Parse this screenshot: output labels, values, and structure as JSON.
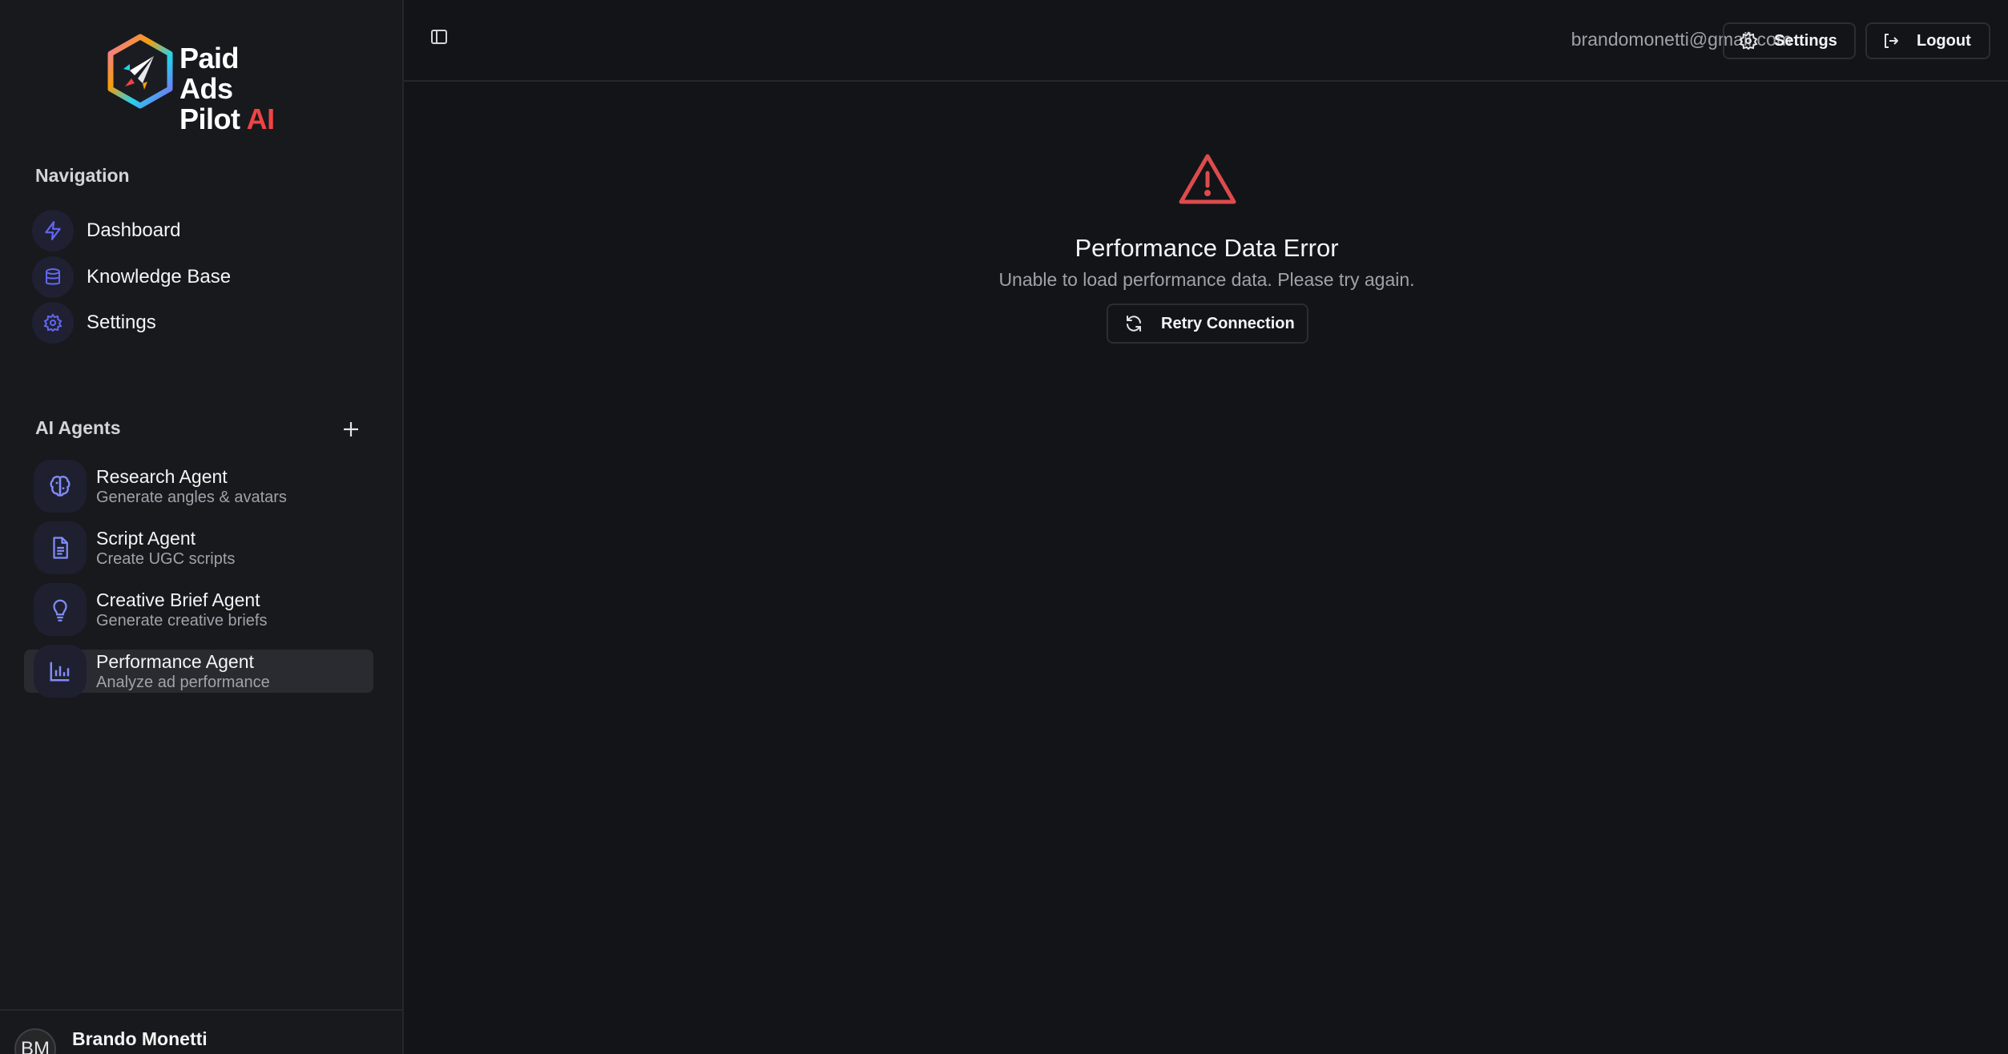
{
  "brand": {
    "line1": "Paid Ads",
    "line2": "Pilot",
    "line2_accent": "AI"
  },
  "navigation": {
    "heading": "Navigation",
    "items": [
      {
        "label": "Dashboard",
        "icon": "bolt-icon"
      },
      {
        "label": "Knowledge Base",
        "icon": "database-icon"
      },
      {
        "label": "Settings",
        "icon": "gear-icon"
      }
    ]
  },
  "agents": {
    "heading": "AI Agents",
    "items": [
      {
        "name": "Research Agent",
        "desc": "Generate angles & avatars",
        "icon": "brain-icon"
      },
      {
        "name": "Script Agent",
        "desc": "Create UGC scripts",
        "icon": "document-icon"
      },
      {
        "name": "Creative Brief Agent",
        "desc": "Generate creative briefs",
        "icon": "lightbulb-icon"
      },
      {
        "name": "Performance Agent",
        "desc": "Analyze ad performance",
        "icon": "bar-chart-icon",
        "active": true
      }
    ]
  },
  "user": {
    "initials": "BM",
    "name": "Brando Monetti"
  },
  "header": {
    "email": "brandomonetti@gmail.com",
    "settings_label": "Settings",
    "logout_label": "Logout"
  },
  "error": {
    "title": "Performance Data Error",
    "message": "Unable to load performance data. Please try again.",
    "retry_label": "Retry Connection"
  },
  "colors": {
    "background": "#131418",
    "sidebar": "#18191d",
    "accent": "#6366f1",
    "error": "#dc4c4c",
    "brand_ai": "#ef4444"
  }
}
